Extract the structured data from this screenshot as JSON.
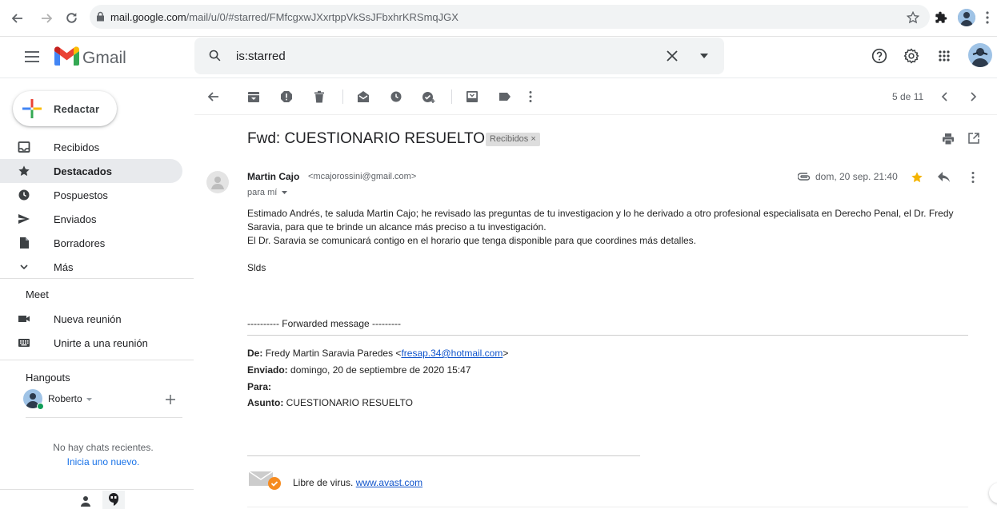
{
  "browser": {
    "url_host": "mail.google.com",
    "url_path": "/mail/u/0/#starred/FMfcgxwJXxrtppVkSsJFbxhrKRSmqJGX"
  },
  "header": {
    "app_name": "Gmail",
    "search_value": "is:starred"
  },
  "sidebar": {
    "compose_label": "Redactar",
    "items": [
      {
        "label": "Recibidos",
        "icon": "inbox-icon"
      },
      {
        "label": "Destacados",
        "icon": "star-icon",
        "active": true
      },
      {
        "label": "Pospuestos",
        "icon": "clock-icon"
      },
      {
        "label": "Enviados",
        "icon": "send-icon"
      },
      {
        "label": "Borradores",
        "icon": "draft-icon"
      },
      {
        "label": "Más",
        "icon": "chevron-down-icon"
      }
    ],
    "meet": {
      "title": "Meet",
      "new_meeting": "Nueva reunión",
      "join_meeting": "Unirte a una reunión"
    },
    "hangouts": {
      "title": "Hangouts",
      "user": "Roberto",
      "no_chats": "No hay chats recientes.",
      "start_new": "Inicia uno nuevo."
    }
  },
  "toolbar": {
    "pagination": "5 de 11"
  },
  "email": {
    "subject": "Fwd: CUESTIONARIO RESUELTO",
    "label_chip": "Recibidos",
    "label_chip_close": "×",
    "sender_name": "Martin Cajo",
    "sender_email": "<mcajorossini@gmail.com>",
    "to_line": "para mí",
    "date": "dom, 20 sep. 21:40",
    "body": [
      "Estimado Andrés, te saluda Martin Cajo; he revisado las preguntas de tu investigacion y lo he derivado a otro profesional especialisata en Derecho Penal, el Dr. Fredy",
      "Saravia, para que te brinde un alcance más preciso a tu investigación.",
      "El Dr. Saravia se comunicará contigo en el horario que tenga disponible para que coordines más detalles."
    ],
    "signoff": "Slds",
    "forwarded_header": "---------- Forwarded message ---------",
    "fwd": {
      "from_label": "De:",
      "from_value": "Fredy Martin Saravia Paredes <",
      "from_email": "fresap.34@hotmail.com",
      "from_close": ">",
      "sent_label": "Enviado:",
      "sent_value": "domingo, 20 de septiembre de 2020 15:47",
      "to_label": "Para:",
      "subject_label": "Asunto:",
      "subject_value": "CUESTIONARIO RESUELTO"
    },
    "avast_text": "Libre de virus.",
    "avast_link": "www.avast.com"
  },
  "colors": {
    "star": "#f4b400",
    "link": "#1155cc",
    "active_nav": "#e8eaed",
    "avast_orange": "#f68b1f"
  }
}
